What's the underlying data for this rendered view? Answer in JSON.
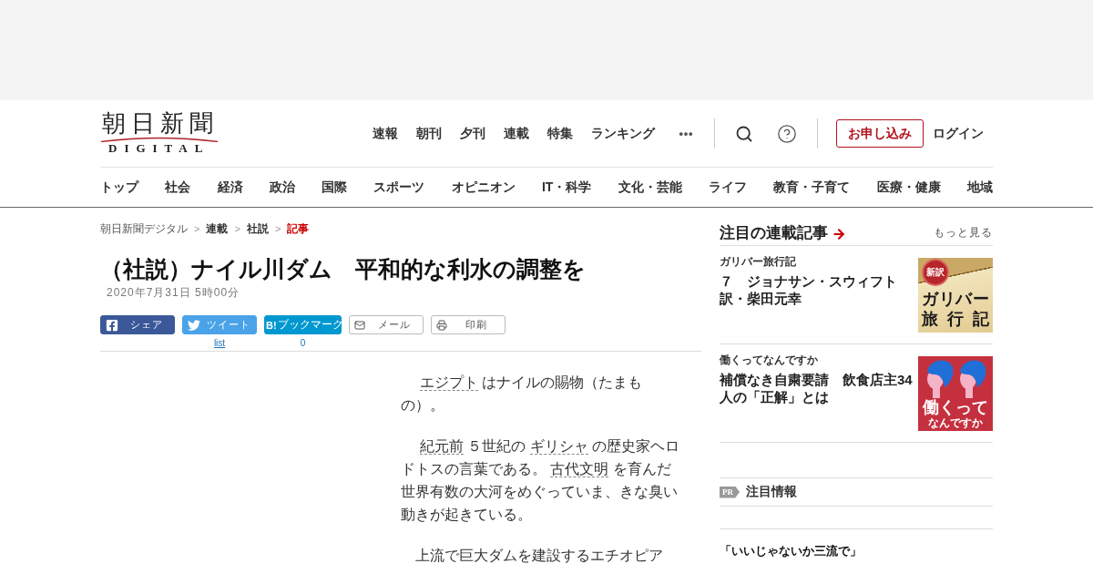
{
  "header": {
    "logo": {
      "title": "朝日新聞",
      "subtitle": "DIGITAL"
    },
    "nav": [
      "速報",
      "朝刊",
      "夕刊",
      "連載",
      "特集",
      "ランキング"
    ],
    "subscribe_button": "お申し込み",
    "login": "ログイン"
  },
  "categories": [
    "トップ",
    "社会",
    "経済",
    "政治",
    "国際",
    "スポーツ",
    "オピニオン",
    "IT・科学",
    "文化・芸能",
    "ライフ",
    "教育・子育て",
    "医療・健康",
    "地域"
  ],
  "breadcrumbs": [
    {
      "kind": "link",
      "label": "朝日新聞デジタル"
    },
    {
      "kind": "separator",
      "label": ">"
    },
    {
      "kind": "section",
      "label": "連載"
    },
    {
      "kind": "separator",
      "label": ">"
    },
    {
      "kind": "section",
      "label": "社説"
    },
    {
      "kind": "separator",
      "label": ">"
    },
    {
      "kind": "current",
      "label": "記事"
    }
  ],
  "article": {
    "title": "（社説）ナイル川ダム　平和的な利水の調整を",
    "date": "2020年7月31日 5時00分",
    "share": [
      {
        "kind": "facebook",
        "label": "シェア"
      },
      {
        "kind": "twitter",
        "label": "ツイート",
        "count": {
          "kind": "link",
          "text": "list"
        }
      },
      {
        "kind": "hatena",
        "logo": "B!",
        "label": "ブックマーク",
        "count": {
          "kind": "number",
          "text": "0"
        }
      },
      {
        "kind": "mail",
        "label": "メール"
      },
      {
        "kind": "print",
        "label": "印刷"
      }
    ],
    "paragraphs": [
      [
        {
          "kind": "link",
          "text": "エジプト"
        },
        {
          "kind": "text",
          "text": " はナイルの賜物（たまもの）。"
        }
      ],
      [
        {
          "kind": "link",
          "text": "紀元前"
        },
        {
          "kind": "text",
          "text": " ５世紀の "
        },
        {
          "kind": "link",
          "text": "ギリシャ"
        },
        {
          "kind": "text",
          "text": " の歴史家ヘロドトスの言葉である。 "
        },
        {
          "kind": "link",
          "text": "古代文明"
        },
        {
          "kind": "text",
          "text": " を育んだ世界有数の大河をめぐっていま、きな臭い動きが起きている。"
        }
      ],
      [
        {
          "kind": "text",
          "text": "上流で巨大ダムを建設するエチオピア"
        }
      ]
    ]
  },
  "sidebar": {
    "title": "注目の連載記事",
    "more": "もっと見る",
    "items": [
      {
        "category": "ガリバー旅行記",
        "title_lines": [
          "７　ジョナサン・スウィフト",
          "訳・柴田元幸"
        ],
        "thumbnail": {
          "kind": "seal",
          "badge": "新訳",
          "lines": [
            "ガリバー",
            "旅行記"
          ]
        }
      },
      {
        "category": "働くってなんですか",
        "title_lines": [
          "補償なき自粛要請　飲食店主34",
          "人の「正解」とは"
        ],
        "thumbnail": {
          "kind": "figures",
          "lines": [
            "働くって",
            "なんですか"
          ]
        }
      }
    ],
    "pr": {
      "badge": "PR",
      "title": "注目情報"
    },
    "feature": {
      "title": "「いいじゃないか三流で」"
    }
  }
}
